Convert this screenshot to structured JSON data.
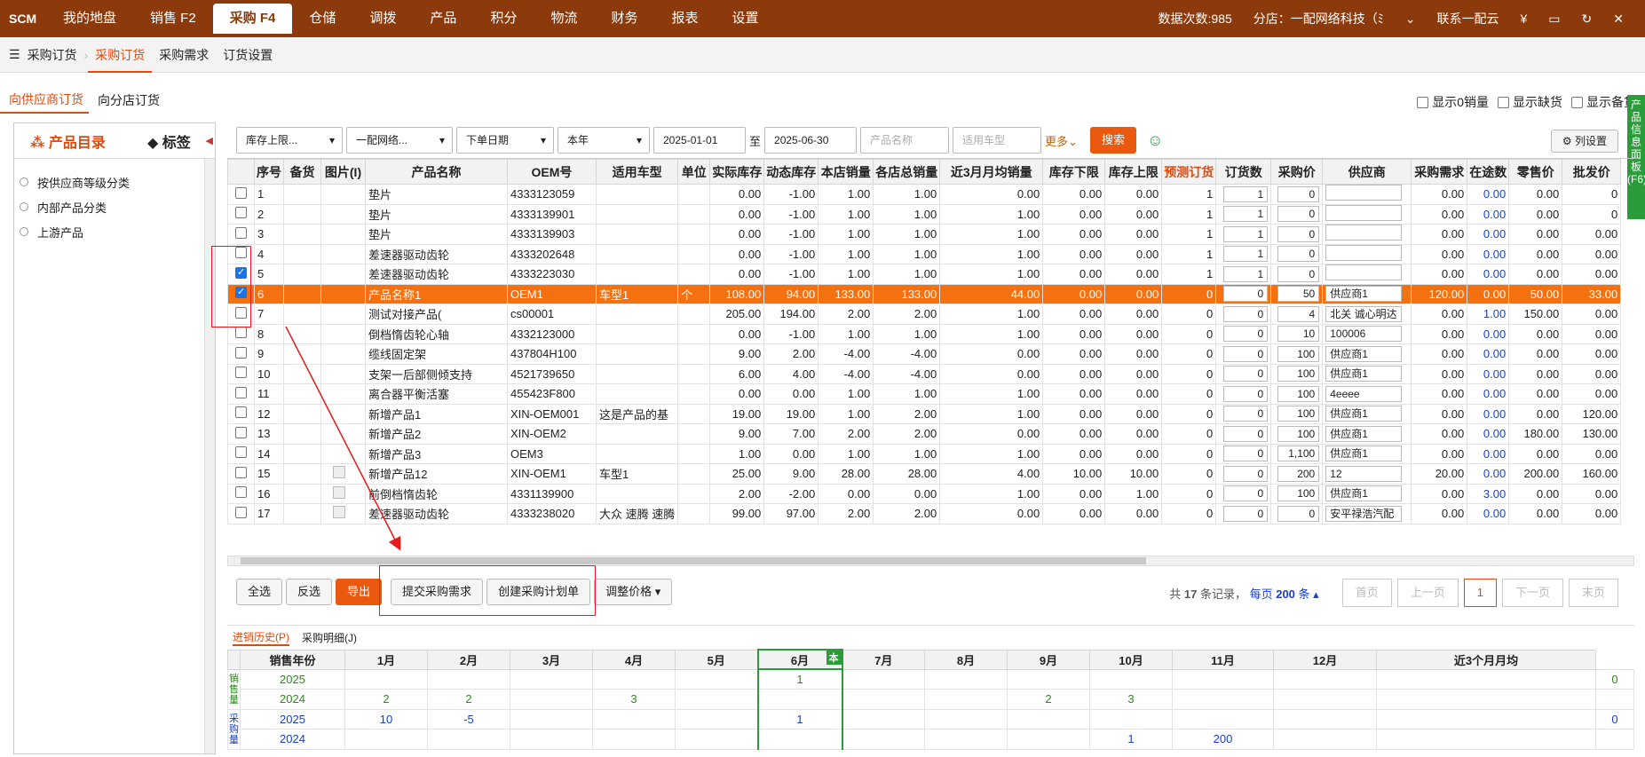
{
  "topbar": {
    "logo": "SCM",
    "nav": [
      "我的地盘",
      "销售 F2",
      "采购 F4",
      "仓储",
      "调拨",
      "产品",
      "积分",
      "物流",
      "财务",
      "报表",
      "设置"
    ],
    "active_nav": "采购 F4",
    "data_count": "数据次数:985",
    "branch": "分店：一配网络科技（ﾐ",
    "contact": "联系一配云",
    "currency": "¥"
  },
  "subbar": {
    "items": [
      "采购订货",
      "采购订货",
      "采购需求",
      "订货设置"
    ],
    "active": 1
  },
  "modebar": {
    "modes": [
      "向供应商订货",
      "向分店订货"
    ],
    "checks": [
      "显示0销量",
      "显示缺货",
      "显示备货"
    ]
  },
  "leftpanel": {
    "tab1": "产品目录",
    "tab2": "标签",
    "tree": [
      "按供应商等级分类",
      "内部产品分类",
      "上游产品"
    ]
  },
  "filters": {
    "stock_limit": "库存上限...",
    "company": "一配网络...",
    "date_type": "下单日期",
    "period": "本年",
    "date_from": "2025-01-01",
    "to_label": "至",
    "date_to": "2025-06-30",
    "product_name_ph": "产品名称",
    "car_model_ph": "适用车型",
    "more": "更多",
    "search": "搜索",
    "colset": "列设置"
  },
  "sidepanel": "产品信息面板(F6)",
  "grid": {
    "headers": [
      "",
      "序号",
      "备货",
      "图片(I)",
      "产品名称",
      "OEM号",
      "适用车型",
      "单位",
      "实际库存",
      "动态库存",
      "本店销量",
      "各店总销量",
      "近3月月均销量",
      "库存下限",
      "库存上限",
      "预测订货",
      "订货数",
      "采购价",
      "供应商",
      "采购需求",
      "在途数",
      "零售价",
      "批发价"
    ],
    "rows": [
      {
        "no": "1",
        "name": "垫片",
        "oem": "4333123059",
        "car": "",
        "unit": "",
        "stock": "0.00",
        "dyn": "-1.00",
        "sales": "1.00",
        "total": "1.00",
        "avg": "0.00",
        "lo": "0.00",
        "hi": "0.00",
        "pred": "1",
        "qty": "1",
        "price": "0",
        "sup": "",
        "need": "0.00",
        "transit": "0.00",
        "retail": "0.00",
        "whole": "0",
        "checked": false,
        "img": false
      },
      {
        "no": "2",
        "name": "垫片",
        "oem": "4333139901",
        "car": "",
        "unit": "",
        "stock": "0.00",
        "dyn": "-1.00",
        "sales": "1.00",
        "total": "1.00",
        "avg": "1.00",
        "lo": "0.00",
        "hi": "0.00",
        "pred": "1",
        "qty": "1",
        "price": "0",
        "sup": "",
        "need": "0.00",
        "transit": "0.00",
        "retail": "0.00",
        "whole": "0",
        "checked": false,
        "img": false
      },
      {
        "no": "3",
        "name": "垫片",
        "oem": "4333139903",
        "car": "",
        "unit": "",
        "stock": "0.00",
        "dyn": "-1.00",
        "sales": "1.00",
        "total": "1.00",
        "avg": "1.00",
        "lo": "0.00",
        "hi": "0.00",
        "pred": "1",
        "qty": "1",
        "price": "0",
        "sup": "",
        "need": "0.00",
        "transit": "0.00",
        "retail": "0.00",
        "whole": "0.00",
        "checked": false,
        "img": false
      },
      {
        "no": "4",
        "name": "差速器驱动齿轮",
        "oem": "4333202648",
        "car": "",
        "unit": "",
        "stock": "0.00",
        "dyn": "-1.00",
        "sales": "1.00",
        "total": "1.00",
        "avg": "1.00",
        "lo": "0.00",
        "hi": "0.00",
        "pred": "1",
        "qty": "1",
        "price": "0",
        "sup": "",
        "need": "0.00",
        "transit": "0.00",
        "retail": "0.00",
        "whole": "0.00",
        "checked": false,
        "img": false
      },
      {
        "no": "5",
        "name": "差速器驱动齿轮",
        "oem": "4333223030",
        "car": "",
        "unit": "",
        "stock": "0.00",
        "dyn": "-1.00",
        "sales": "1.00",
        "total": "1.00",
        "avg": "1.00",
        "lo": "0.00",
        "hi": "0.00",
        "pred": "1",
        "qty": "1",
        "price": "0",
        "sup": "",
        "need": "0.00",
        "transit": "0.00",
        "retail": "0.00",
        "whole": "0.00",
        "checked": true,
        "img": false
      },
      {
        "no": "6",
        "name": "产品名称1",
        "oem": "OEM1",
        "car": "车型1",
        "unit": "个",
        "stock": "108.00",
        "dyn": "94.00",
        "sales": "133.00",
        "total": "133.00",
        "avg": "44.00",
        "lo": "0.00",
        "hi": "0.00",
        "pred": "0",
        "qty": "0",
        "price": "50",
        "sup": "供应商1",
        "need": "120.00",
        "transit": "0.00",
        "retail": "50.00",
        "whole": "33.00",
        "checked": true,
        "img": false,
        "hl": true
      },
      {
        "no": "7",
        "name": "测试对接产品(",
        "oem": "cs00001",
        "car": "",
        "unit": "",
        "stock": "205.00",
        "dyn": "194.00",
        "sales": "2.00",
        "total": "2.00",
        "avg": "1.00",
        "lo": "0.00",
        "hi": "0.00",
        "pred": "0",
        "qty": "0",
        "price": "4",
        "sup": "北关 诚心明达",
        "need": "0.00",
        "transit": "1.00",
        "retail": "150.00",
        "whole": "0.00",
        "checked": false,
        "img": false
      },
      {
        "no": "8",
        "name": "倒档惰齿轮心轴",
        "oem": "4332123000",
        "car": "",
        "unit": "",
        "stock": "0.00",
        "dyn": "-1.00",
        "sales": "1.00",
        "total": "1.00",
        "avg": "1.00",
        "lo": "0.00",
        "hi": "0.00",
        "pred": "0",
        "qty": "0",
        "price": "10",
        "sup": "100006",
        "need": "0.00",
        "transit": "0.00",
        "retail": "0.00",
        "whole": "0.00",
        "checked": false,
        "img": false
      },
      {
        "no": "9",
        "name": "缆线固定架",
        "oem": "437804H100",
        "car": "",
        "unit": "",
        "stock": "9.00",
        "dyn": "2.00",
        "sales": "-4.00",
        "total": "-4.00",
        "avg": "0.00",
        "lo": "0.00",
        "hi": "0.00",
        "pred": "0",
        "qty": "0",
        "price": "100",
        "sup": "供应商1",
        "need": "0.00",
        "transit": "0.00",
        "retail": "0.00",
        "whole": "0.00",
        "checked": false,
        "img": false
      },
      {
        "no": "10",
        "name": "支架一后部侧倾支持",
        "oem": "4521739650",
        "car": "",
        "unit": "",
        "stock": "6.00",
        "dyn": "4.00",
        "sales": "-4.00",
        "total": "-4.00",
        "avg": "0.00",
        "lo": "0.00",
        "hi": "0.00",
        "pred": "0",
        "qty": "0",
        "price": "100",
        "sup": "供应商1",
        "need": "0.00",
        "transit": "0.00",
        "retail": "0.00",
        "whole": "0.00",
        "checked": false,
        "img": false
      },
      {
        "no": "11",
        "name": "离合器平衡活塞",
        "oem": "455423F800",
        "car": "",
        "unit": "",
        "stock": "0.00",
        "dyn": "0.00",
        "sales": "1.00",
        "total": "1.00",
        "avg": "1.00",
        "lo": "0.00",
        "hi": "0.00",
        "pred": "0",
        "qty": "0",
        "price": "100",
        "sup": "4eeee",
        "need": "0.00",
        "transit": "0.00",
        "retail": "0.00",
        "whole": "0.00",
        "checked": false,
        "img": false
      },
      {
        "no": "12",
        "name": "新增产品1",
        "oem": "XIN-OEM001",
        "car": "这是产品的基",
        "unit": "",
        "stock": "19.00",
        "dyn": "19.00",
        "sales": "1.00",
        "total": "2.00",
        "avg": "1.00",
        "lo": "0.00",
        "hi": "0.00",
        "pred": "0",
        "qty": "0",
        "price": "100",
        "sup": "供应商1",
        "need": "0.00",
        "transit": "0.00",
        "retail": "0.00",
        "whole": "120.00",
        "checked": false,
        "img": false
      },
      {
        "no": "13",
        "name": "新增产品2",
        "oem": "XIN-OEM2",
        "car": "",
        "unit": "",
        "stock": "9.00",
        "dyn": "7.00",
        "sales": "2.00",
        "total": "2.00",
        "avg": "0.00",
        "lo": "0.00",
        "hi": "0.00",
        "pred": "0",
        "qty": "0",
        "price": "100",
        "sup": "供应商1",
        "need": "0.00",
        "transit": "0.00",
        "retail": "180.00",
        "whole": "130.00",
        "checked": false,
        "img": false
      },
      {
        "no": "14",
        "name": "新增产品3",
        "oem": "OEM3",
        "car": "",
        "unit": "",
        "stock": "1.00",
        "dyn": "0.00",
        "sales": "1.00",
        "total": "1.00",
        "avg": "1.00",
        "lo": "0.00",
        "hi": "0.00",
        "pred": "0",
        "qty": "0",
        "price": "1,100",
        "sup": "供应商1",
        "need": "0.00",
        "transit": "0.00",
        "retail": "0.00",
        "whole": "0.00",
        "checked": false,
        "img": false
      },
      {
        "no": "15",
        "name": "新增产品12",
        "oem": "XIN-OEM1",
        "car": "车型1",
        "unit": "",
        "stock": "25.00",
        "dyn": "9.00",
        "sales": "28.00",
        "total": "28.00",
        "avg": "4.00",
        "lo": "10.00",
        "hi": "10.00",
        "pred": "0",
        "qty": "0",
        "price": "200",
        "sup": "12",
        "need": "20.00",
        "transit": "0.00",
        "retail": "200.00",
        "whole": "160.00",
        "checked": false,
        "img": true
      },
      {
        "no": "16",
        "name": "前倒档惰齿轮",
        "oem": "4331139900",
        "car": "",
        "unit": "",
        "stock": "2.00",
        "dyn": "-2.00",
        "sales": "0.00",
        "total": "0.00",
        "avg": "1.00",
        "lo": "0.00",
        "hi": "1.00",
        "pred": "0",
        "qty": "0",
        "price": "100",
        "sup": "供应商1",
        "need": "0.00",
        "transit": "3.00",
        "retail": "0.00",
        "whole": "0.00",
        "checked": false,
        "img": true
      },
      {
        "no": "17",
        "name": "差速器驱动齿轮",
        "oem": "4333238020",
        "car": "大众 速腾 速腾",
        "unit": "",
        "stock": "99.00",
        "dyn": "97.00",
        "sales": "2.00",
        "total": "2.00",
        "avg": "0.00",
        "lo": "0.00",
        "hi": "0.00",
        "pred": "0",
        "qty": "0",
        "price": "0",
        "sup": "安平禄浩汽配",
        "need": "0.00",
        "transit": "0.00",
        "retail": "0.00",
        "whole": "0.00",
        "checked": false,
        "img": true
      }
    ]
  },
  "actions": {
    "select_all": "全选",
    "invert": "反选",
    "export": "导出",
    "submit_need": "提交采购需求",
    "create_plan": "创建采购计划单",
    "adjust_price": "调整价格"
  },
  "pager": {
    "total_prefix": "共",
    "total": "17",
    "total_suffix": "条记录，",
    "per_page_prefix": "每页",
    "per_page": "200",
    "per_page_suffix": "条",
    "first": "首页",
    "prev": "上一页",
    "current": "1",
    "next": "下一页",
    "last": "末页"
  },
  "history": {
    "tab1": "进销历史(P)",
    "tab2": "采购明细(J)",
    "headers": [
      "",
      "销售年份",
      "1月",
      "2月",
      "3月",
      "4月",
      "5月",
      "6月",
      "7月",
      "8月",
      "9月",
      "10月",
      "11月",
      "12月",
      "近3个月月均"
    ],
    "current_badge": "本",
    "sales_label": "销售量",
    "purchase_label": "采购量",
    "rows": [
      {
        "year": "2025",
        "cells": [
          "",
          "",
          "",
          "",
          "",
          "1",
          "",
          "",
          "",
          "",
          "",
          "",
          ""
        ],
        "avg": "0",
        "cls": "g"
      },
      {
        "year": "2024",
        "cells": [
          "2",
          "2",
          "",
          "3",
          "",
          "",
          "",
          "",
          "2",
          "3",
          "",
          "",
          ""
        ],
        "avg": "",
        "cls": "g"
      },
      {
        "year": "2025",
        "cells": [
          "10",
          "-5",
          "",
          "",
          "",
          "1",
          "",
          "",
          "",
          "",
          "",
          "",
          ""
        ],
        "avg": "0",
        "cls": "b"
      },
      {
        "year": "2024",
        "cells": [
          "",
          "",
          "",
          "",
          "",
          "",
          "",
          "",
          "",
          "1",
          "200",
          "",
          ""
        ],
        "avg": "",
        "cls": "b"
      }
    ]
  }
}
